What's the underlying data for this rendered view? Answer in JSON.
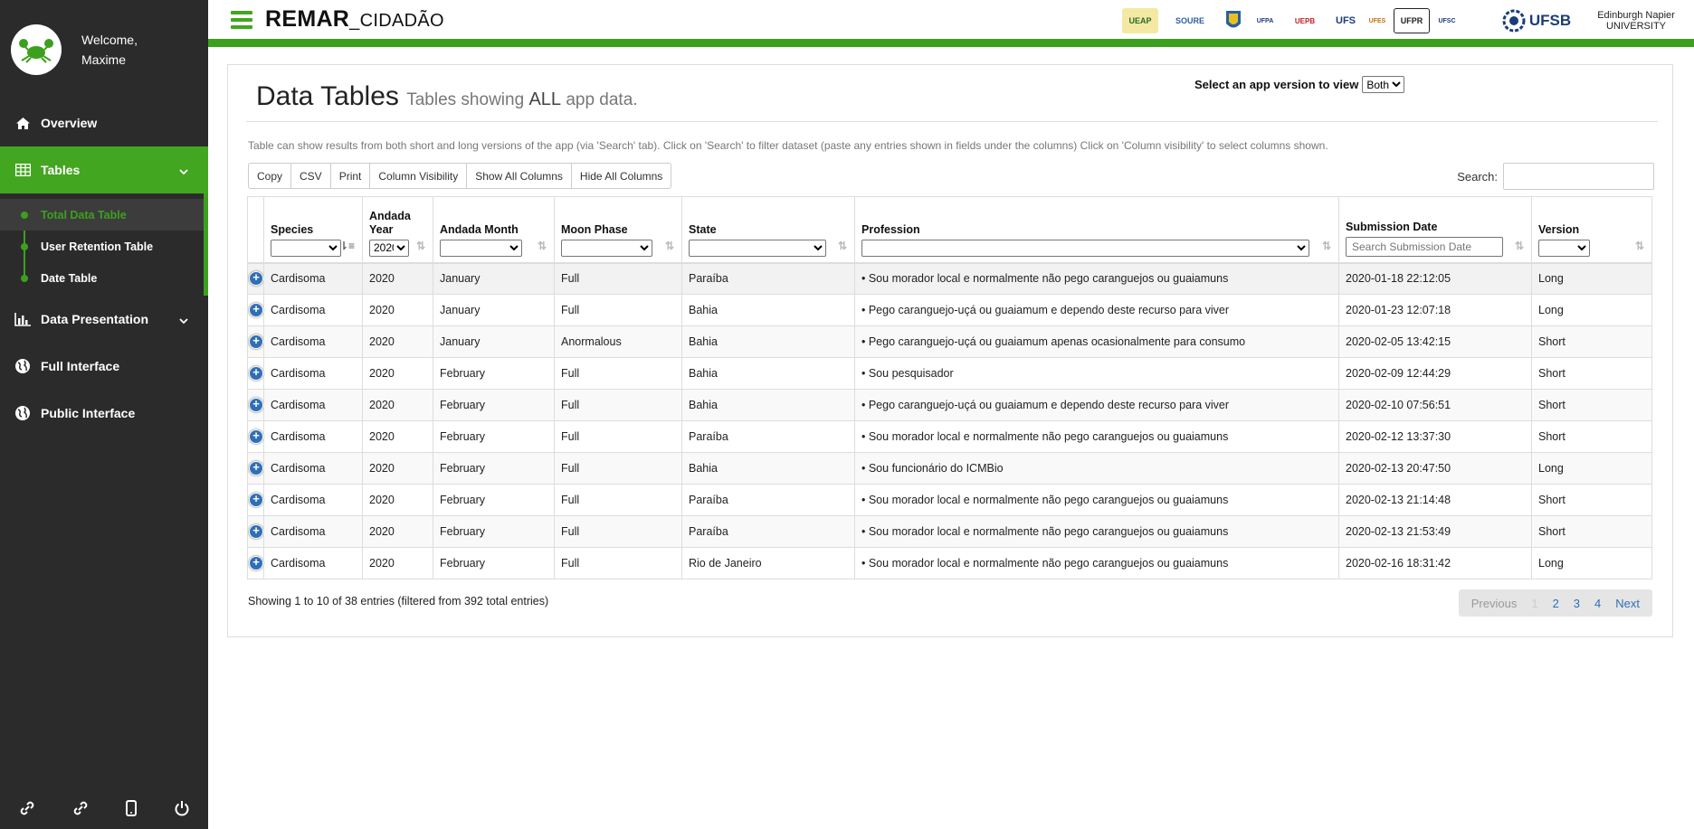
{
  "user": {
    "welcome": "Welcome,",
    "name": "Maxime"
  },
  "nav": {
    "overview": "Overview",
    "tables": "Tables",
    "sub": [
      "Total Data Table",
      "User Retention Table",
      "Date Table"
    ],
    "data_presentation": "Data Presentation",
    "full_interface": "Full Interface",
    "public_interface": "Public Interface"
  },
  "topbar": {
    "brand_main": "REMAR",
    "brand_sub": "_CIDADÃO",
    "logos": [
      "UEAP",
      "SOURE",
      "UFPA",
      "UEPB",
      "UFS",
      "UFES",
      "UFPR",
      "UFSC",
      "UFSB",
      "Edinburgh Napier UNIVERSITY"
    ]
  },
  "header": {
    "title": "Data Tables",
    "subtitle_pre": "Tables showing",
    "subtitle_bold": "ALL",
    "subtitle_post": "app data.",
    "version_label": "Select an app version to view",
    "version_value": "Both"
  },
  "help_text": "Table can show results from both short and long versions of the app (via 'Search' tab). Click on 'Search' to filter dataset (paste any entries shown in fields under the columns) Click on 'Column visibility' to select columns shown.",
  "buttons": [
    "Copy",
    "CSV",
    "Print",
    "Column Visibility",
    "Show All Columns",
    "Hide All Columns"
  ],
  "search_label": "Search:",
  "columns": {
    "species": "Species",
    "andada_year": "Andada Year",
    "andada_year_filter": "2020",
    "andada_month": "Andada Month",
    "moon_phase": "Moon Phase",
    "state": "State",
    "profession": "Profession",
    "submission_date": "Submission Date",
    "submission_placeholder": "Search Submission Date",
    "version": "Version"
  },
  "rows": [
    [
      "Cardisoma",
      "2020",
      "January",
      "Full",
      "Paraíba",
      "• Sou morador local e normalmente não pego caranguejos ou guaiamuns",
      "2020-01-18 22:12:05",
      "Long"
    ],
    [
      "Cardisoma",
      "2020",
      "January",
      "Full",
      "Bahia",
      "• Pego caranguejo-uçá ou guaiamum e dependo deste recurso para viver",
      "2020-01-23 12:07:18",
      "Long"
    ],
    [
      "Cardisoma",
      "2020",
      "January",
      "Anormalous",
      "Bahia",
      "• Pego caranguejo-uçá ou guaiamum apenas ocasionalmente para consumo",
      "2020-02-05 13:42:15",
      "Short"
    ],
    [
      "Cardisoma",
      "2020",
      "February",
      "Full",
      "Bahia",
      "• Sou pesquisador",
      "2020-02-09 12:44:29",
      "Short"
    ],
    [
      "Cardisoma",
      "2020",
      "February",
      "Full",
      "Bahia",
      "• Pego caranguejo-uçá ou guaiamum e dependo deste recurso para viver",
      "2020-02-10 07:56:51",
      "Short"
    ],
    [
      "Cardisoma",
      "2020",
      "February",
      "Full",
      "Paraíba",
      "• Sou morador local e normalmente não pego caranguejos ou guaiamuns",
      "2020-02-12 13:37:30",
      "Short"
    ],
    [
      "Cardisoma",
      "2020",
      "February",
      "Full",
      "Bahia",
      "• Sou funcionário do ICMBio",
      "2020-02-13 20:47:50",
      "Long"
    ],
    [
      "Cardisoma",
      "2020",
      "February",
      "Full",
      "Paraíba",
      "• Sou morador local e normalmente não pego caranguejos ou guaiamuns",
      "2020-02-13 21:14:48",
      "Short"
    ],
    [
      "Cardisoma",
      "2020",
      "February",
      "Full",
      "Paraíba",
      "• Sou morador local e normalmente não pego caranguejos ou guaiamuns",
      "2020-02-13 21:53:49",
      "Short"
    ],
    [
      "Cardisoma",
      "2020",
      "February",
      "Full",
      "Rio de Janeiro",
      "• Sou morador local e normalmente não pego caranguejos ou guaiamuns",
      "2020-02-16 18:31:42",
      "Long"
    ]
  ],
  "footer": {
    "info": "Showing 1 to 10 of 38 entries (filtered from 392 total entries)",
    "previous": "Previous",
    "pages": [
      "1",
      "2",
      "3",
      "4"
    ],
    "next": "Next"
  },
  "colors": {
    "green": "#3ca01e",
    "sidebar": "#2b2b2b",
    "link_blue": "#2f6fb5"
  }
}
